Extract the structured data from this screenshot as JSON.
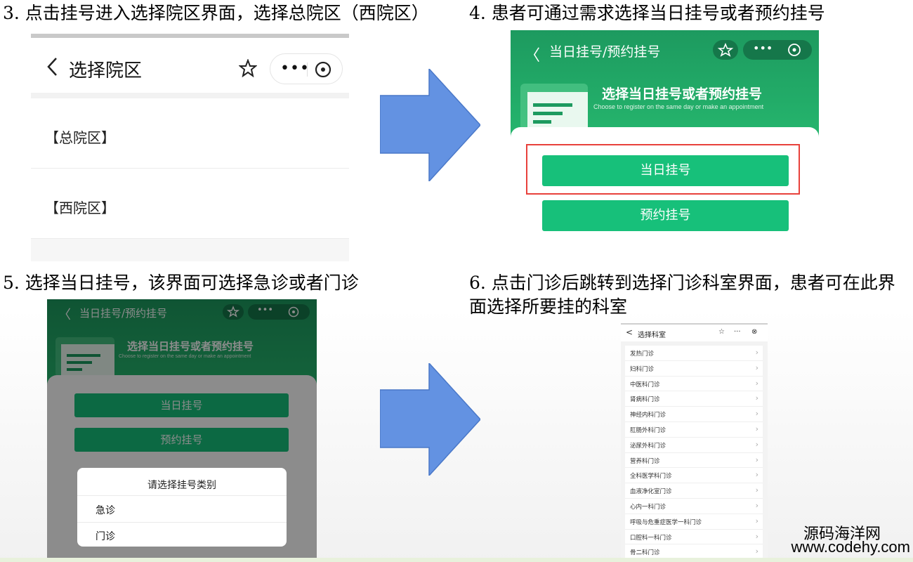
{
  "steps": {
    "s3": "3. 点击挂号进入选择院区界面，选择总院区（西院区）",
    "s4": "4. 患者可通过需求选择当日挂号或者预约挂号",
    "s5": "5. 选择当日挂号，该界面可选择急诊或者门诊",
    "s6_line1": "6. 点击门诊后跳转到选择门诊科室界面，患者可在此界",
    "s6_line2": "面选择所要挂的科室"
  },
  "campus_screen": {
    "title": "选择院区",
    "campuses": [
      "【总院区】",
      "【西院区】"
    ]
  },
  "registration_screen": {
    "title": "当日挂号/预约挂号",
    "banner_title": "选择当日挂号或者预约挂号",
    "banner_subtitle": "Choose to register on the same day or make an appointment",
    "same_day_button": "当日挂号",
    "appointment_button": "预约挂号"
  },
  "category_dialog": {
    "title": "请选择挂号类别",
    "options": [
      "急诊",
      "门诊"
    ]
  },
  "department_screen": {
    "title": "选择科室",
    "departments": [
      "发热门诊",
      "妇科门诊",
      "中医科门诊",
      "肾病科门诊",
      "神经内科门诊",
      "肛肠外科门诊",
      "泌尿外科门诊",
      "营养科门诊",
      "全科医学科门诊",
      "血液净化室门诊",
      "心内一科门诊",
      "呼吸与危重症医学一科门诊",
      "口腔科一科门诊",
      "骨二科门诊"
    ]
  },
  "watermark": {
    "line1": "源码海洋网",
    "line2": "www.codehy.com"
  },
  "colors": {
    "accent_green": "#17c07a",
    "header_green": "#1d9a5f",
    "arrow_blue": "#6392e2",
    "highlight_red": "#e8413b"
  },
  "icons": [
    "back-chevron-icon",
    "star-icon",
    "more-dots-icon",
    "close-circle-icon",
    "document-icon",
    "right-arrow-icon",
    "chevron-right-icon"
  ]
}
